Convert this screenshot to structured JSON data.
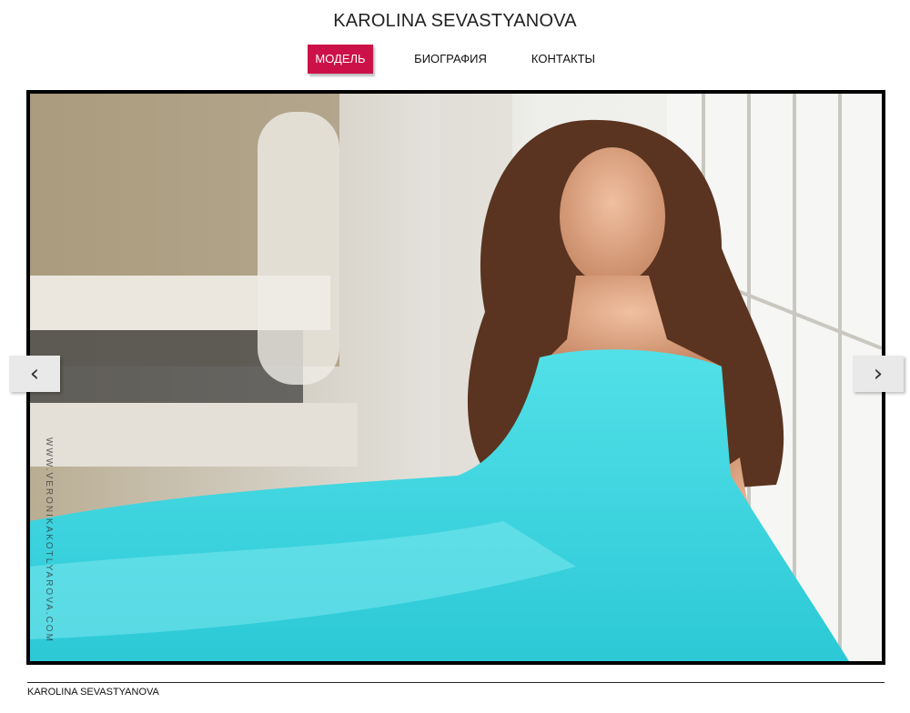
{
  "site": {
    "title": "KAROLINA SEVASTYANOVA"
  },
  "nav": {
    "items": [
      {
        "label": "МОДЕЛЬ",
        "active": true
      },
      {
        "label": "БИОГРАФИЯ",
        "active": false
      },
      {
        "label": "КОНТАКТЫ",
        "active": false
      }
    ]
  },
  "slider": {
    "photo_watermark": "WWW.VERONIKAKOTLYAROVA.COM",
    "prev_icon": "chevron-left-icon",
    "next_icon": "chevron-right-icon",
    "prev_glyph": "‹",
    "next_glyph": "›"
  },
  "footer": {
    "text": "KAROLINA SEVASTYANOVA"
  },
  "colors": {
    "accent": "#cc1148",
    "dress": "#3ed6e0",
    "frame": "#000000"
  }
}
